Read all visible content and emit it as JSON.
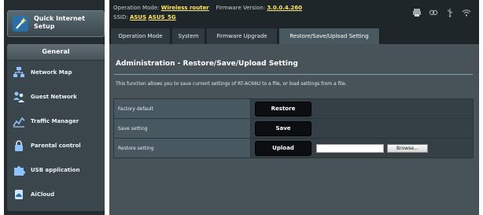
{
  "sidebar": {
    "quick_setup": {
      "label": "Quick Internet Setup",
      "icon": "wand-icon"
    },
    "general_header": "General",
    "items": [
      {
        "label": "Network Map",
        "icon": "network-map-icon"
      },
      {
        "label": "Guest Network",
        "icon": "guest-network-icon"
      },
      {
        "label": "Traffic Manager",
        "icon": "traffic-manager-icon"
      },
      {
        "label": "Parental control",
        "icon": "lock-icon"
      },
      {
        "label": "USB application",
        "icon": "puzzle-icon"
      },
      {
        "label": "AiCloud",
        "icon": "cloud-icon"
      }
    ]
  },
  "topbar": {
    "operation_mode_label": "Operation Mode:",
    "operation_mode_value": "Wireless router",
    "firmware_label": "Firmware Version:",
    "firmware_value": "3.0.0.4.260",
    "ssid_label": "SSID:",
    "ssid_values": [
      "ASUS",
      "ASUS_5G"
    ],
    "icons": [
      "printer-icon",
      "link-icon",
      "usb-icon",
      "wifi-icon"
    ]
  },
  "tabs": [
    {
      "label": "Operation Mode",
      "active": false
    },
    {
      "label": "System",
      "active": false
    },
    {
      "label": "Firmware Upgrade",
      "active": false
    },
    {
      "label": "Restore/Save/Upload Setting",
      "active": true
    }
  ],
  "content": {
    "title": "Administration - Restore/Save/Upload Setting",
    "description": "This function allows you to save current settings of RT-AC66U to a file, or load settings from a file.",
    "rows": [
      {
        "label": "Factory default",
        "button": "Restore"
      },
      {
        "label": "Save setting",
        "button": "Save"
      },
      {
        "label": "Restore setting",
        "button": "Upload",
        "browse": "Browse..."
      }
    ]
  },
  "colors": {
    "accent_value": "#ffe86a",
    "sidebar_bg": "#252c30",
    "content_bg": "#475359"
  }
}
